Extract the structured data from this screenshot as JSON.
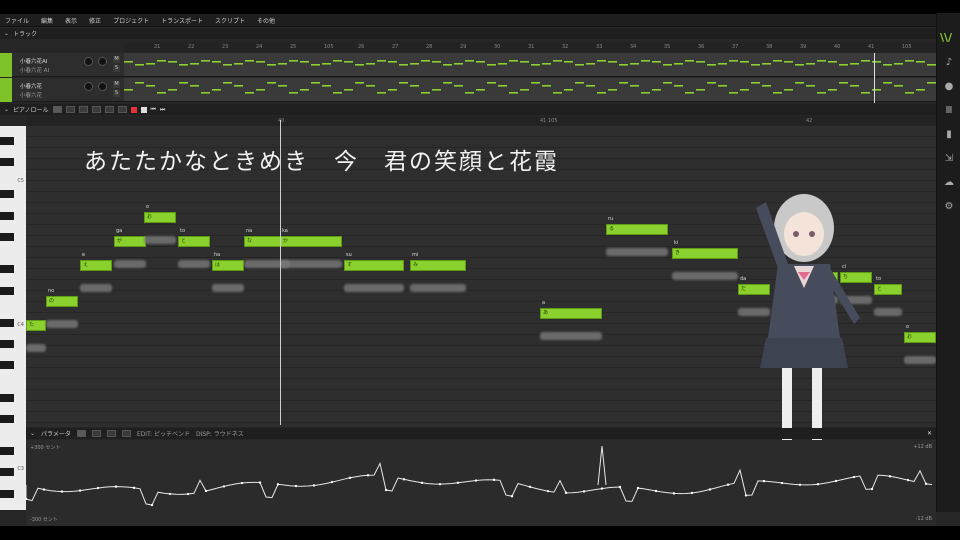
{
  "menu": [
    "ファイル",
    "編集",
    "表示",
    "修正",
    "プロジェクト",
    "トランスポート",
    "スクリプト",
    "その他"
  ],
  "track_panel": {
    "title": "トラック"
  },
  "tracks": [
    {
      "name": "小春六花AI",
      "sub": "小春六花 AI"
    },
    {
      "name": "小春六花",
      "sub": "小春六花"
    }
  ],
  "track_ruler": [
    "21",
    "22",
    "23",
    "24",
    "25",
    "105",
    "26",
    "27",
    "28",
    "29",
    "30",
    "31",
    "32",
    "33",
    "34",
    "35",
    "36",
    "37",
    "38",
    "39",
    "40",
    "41",
    "105"
  ],
  "pianoroll": {
    "title": "ピアノロール"
  },
  "roll_ruler": [
    "40",
    "41  105",
    "42"
  ],
  "key_labels": [
    "C5",
    "C4",
    "C3"
  ],
  "lyrics": "あたたかなときめき　今　君の笑顔と花霞",
  "notes": [
    {
      "lyric": "",
      "text": "た"
    },
    {
      "lyric": "no",
      "text": "の"
    },
    {
      "lyric": "e",
      "text": "え"
    },
    {
      "lyric": "ga",
      "text": "が"
    },
    {
      "lyric": "o",
      "text": "お"
    },
    {
      "lyric": "to",
      "text": "と"
    },
    {
      "lyric": "ha",
      "text": "は"
    },
    {
      "lyric": "na",
      "text": "な"
    },
    {
      "lyric": "ka",
      "text": "か"
    },
    {
      "lyric": "su",
      "text": "す"
    },
    {
      "lyric": "mi",
      "text": "み"
    },
    {
      "lyric": "a",
      "text": "あ"
    },
    {
      "lyric": "ru",
      "text": "る"
    },
    {
      "lyric": "ki",
      "text": "き"
    },
    {
      "lyric": "da",
      "text": "だ"
    },
    {
      "lyric": "ku",
      "text": "く"
    },
    {
      "lyric": "o",
      "text": "お"
    },
    {
      "lyric": "ci",
      "text": "ち"
    },
    {
      "lyric": "to",
      "text": "と"
    },
    {
      "lyric": "o",
      "text": "お"
    }
  ],
  "parameter": {
    "title": "パラメータ",
    "edit_label": "EDIT: ピッチベンド",
    "disp_label": "DISP: ラウドネス",
    "top_left": "+300 セント",
    "bottom_left": "-300 セント",
    "top_right": "+12 dB",
    "bottom_right": "-12 dB"
  },
  "colors": {
    "note": "#8bd12e",
    "accent": "#7fc32a",
    "record": "#e2333a"
  },
  "rail_icons": [
    "logo-icon",
    "music-note-icon",
    "microphone-icon",
    "library-icon",
    "book-icon",
    "export-icon",
    "cloud-icon",
    "gear-icon"
  ]
}
